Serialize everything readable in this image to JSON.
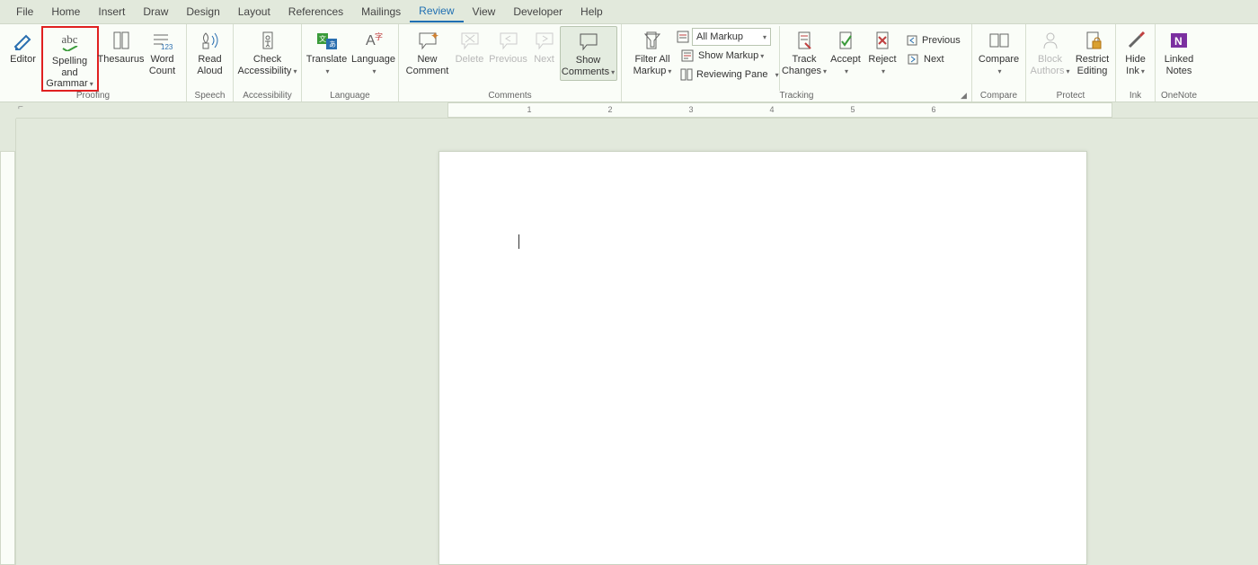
{
  "tabs": {
    "file": "File",
    "home": "Home",
    "insert": "Insert",
    "draw": "Draw",
    "design": "Design",
    "layout": "Layout",
    "references": "References",
    "mailings": "Mailings",
    "review": "Review",
    "view": "View",
    "developer": "Developer",
    "help": "Help"
  },
  "ribbon": {
    "proofing": {
      "label": "Proofing",
      "editor": "Editor",
      "spelling_icon": "abc",
      "spelling": "Spelling and Grammar",
      "thesaurus": "Thesaurus",
      "wordcount": "Word Count"
    },
    "speech": {
      "label": "Speech",
      "readaloud": "Read Aloud"
    },
    "accessibility": {
      "label": "Accessibility",
      "check": "Check Accessibility"
    },
    "language": {
      "label": "Language",
      "translate": "Translate",
      "language": "Language"
    },
    "comments": {
      "label": "Comments",
      "new": "New Comment",
      "delete": "Delete",
      "previous": "Previous",
      "next": "Next",
      "show": "Show Comments"
    },
    "tracking": {
      "label": "Tracking",
      "filter": "Filter All Markup",
      "display_value": "All Markup",
      "showmarkup": "Show Markup",
      "pane": "Reviewing Pane",
      "track": "Track Changes",
      "accept": "Accept",
      "reject": "Reject",
      "previous": "Previous",
      "next": "Next"
    },
    "compare": {
      "label": "Compare",
      "compare": "Compare"
    },
    "protect": {
      "label": "Protect",
      "block": "Block Authors",
      "restrict": "Restrict Editing"
    },
    "ink": {
      "label": "Ink",
      "hide": "Hide Ink"
    },
    "onenote": {
      "label": "OneNote",
      "linked": "Linked Notes"
    }
  },
  "ruler": {
    "marks": [
      "1",
      "2",
      "3",
      "4",
      "5",
      "6"
    ]
  }
}
